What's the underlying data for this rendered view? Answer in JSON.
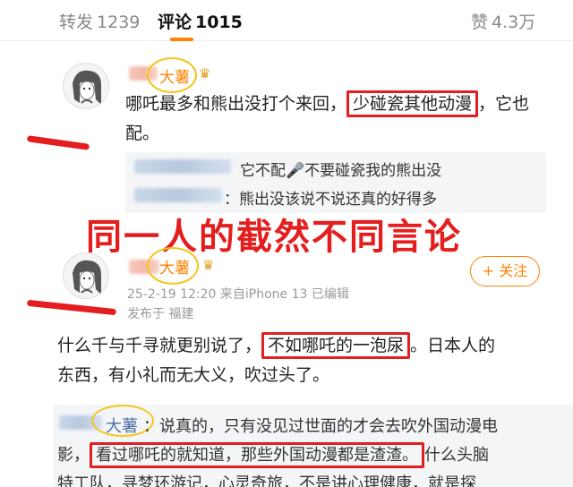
{
  "tabs": {
    "repost_label": "转发",
    "repost_count": "1239",
    "comment_label": "评论",
    "comment_count": "1015",
    "like_label": "赞",
    "like_count": "4.3万"
  },
  "comment1": {
    "username": "大薯",
    "crown": "♛",
    "text_a": "哪吒最多和熊出没打个来回，",
    "text_boxed": "少碰瓷其他动漫",
    "text_b": "，它也",
    "text_c": "配。",
    "replies": [
      {
        "text": "它不配🎤不要碰瓷我的熊出没"
      },
      {
        "text": "：熊出没该说不说还真的好得多"
      }
    ]
  },
  "overlay_caption": "同一人的截然不同言论",
  "comment2": {
    "username": "大薯",
    "crown": "♛",
    "meta_line": "25-2-19 12:20  来自iPhone 13  已编辑",
    "location": "发布于 福建",
    "follow_label": "+ 关注",
    "text_a": "什么千与千寻就更别说了，",
    "text_boxed": "不如哪吒的一泡尿",
    "text_b": "。日本人的",
    "text_c": "东西，有小礼而无大义，吹过头了。"
  },
  "comment3": {
    "username": "大薯",
    "line1": "：说真的，只有没见过世面的才会去吹外国动漫电",
    "line2_a": "影，",
    "line2_boxed": "看过哪吒的就知道，那些外国动漫都是渣渣。",
    "line2_b": "什么头脑",
    "line3": "特工队，寻梦环游记，心灵奇旅，不是讲心理健康，就是探"
  },
  "colors": {
    "accent": "#ff8200",
    "annotation_red": "#e41e1e",
    "highlight_yellow": "#f5c518"
  }
}
